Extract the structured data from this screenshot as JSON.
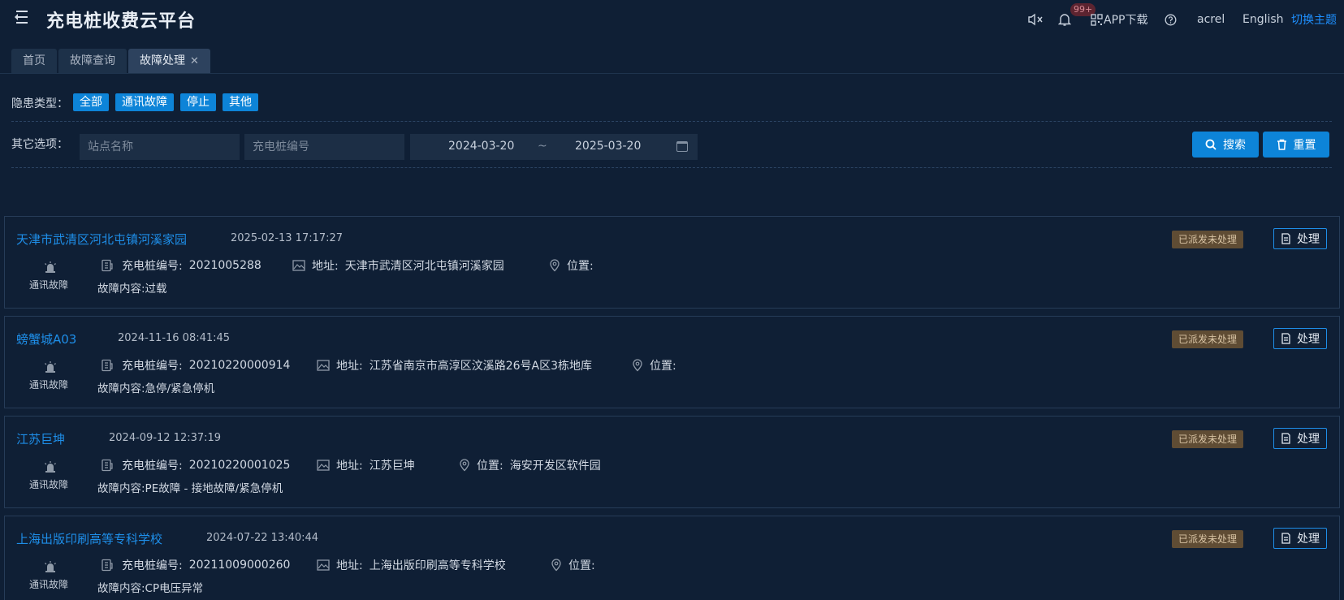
{
  "app": {
    "title": "充电桩收费云平台"
  },
  "header": {
    "mute_icon": "speaker-mute-icon",
    "bell_icon": "bell-icon",
    "notif_count": "99+",
    "app_download": "APP下载",
    "help_icon": "question-circle-icon",
    "username": "acrel",
    "language": "English",
    "theme": "切换主题"
  },
  "tabs": [
    {
      "label": "首页"
    },
    {
      "label": "故障查询"
    },
    {
      "label": "故障处理"
    }
  ],
  "filters": {
    "hazard_label": "隐患类型：",
    "types": [
      "全部",
      "通讯故障",
      "停止",
      "其他"
    ],
    "other_label": "其它选项：",
    "station_placeholder": "站点名称",
    "pile_placeholder": "充电桩编号",
    "date_start": "2024-03-20",
    "date_sep": "~",
    "date_end": "2025-03-20",
    "search_label": "搜索",
    "reset_label": "重置"
  },
  "card_labels": {
    "pile_no": "充电桩编号:",
    "address": "地址:",
    "location": "位置:",
    "handle": "处理"
  },
  "faults": [
    {
      "station": "天津市武清区河北屯镇河溪家园",
      "time": "2025-02-13 17:17:27",
      "type": "通讯故障",
      "pile_no": "2021005288",
      "address": "天津市武清区河北屯镇河溪家园",
      "location": "",
      "content": "故障内容:过载",
      "status": "已派发未处理"
    },
    {
      "station": "螃蟹城A03",
      "time": "2024-11-16 08:41:45",
      "type": "通讯故障",
      "pile_no": "20210220000914",
      "address": "江苏省南京市高淳区汶溪路26号A区3栋地库",
      "location": "",
      "content": "故障内容:急停/紧急停机",
      "status": "已派发未处理"
    },
    {
      "station": "江苏巨坤",
      "time": "2024-09-12 12:37:19",
      "type": "通讯故障",
      "pile_no": "20210220001025",
      "address": "江苏巨坤",
      "location": "海安开发区软件园",
      "content": "故障内容:PE故障 - 接地故障/紧急停机",
      "status": "已派发未处理"
    },
    {
      "station": "上海出版印刷高等专科学校",
      "time": "2024-07-22 13:40:44",
      "type": "通讯故障",
      "pile_no": "20211009000260",
      "address": "上海出版印刷高等专科学校",
      "location": "",
      "content": "故障内容:CP电压异常",
      "status": "已派发未处理"
    }
  ]
}
